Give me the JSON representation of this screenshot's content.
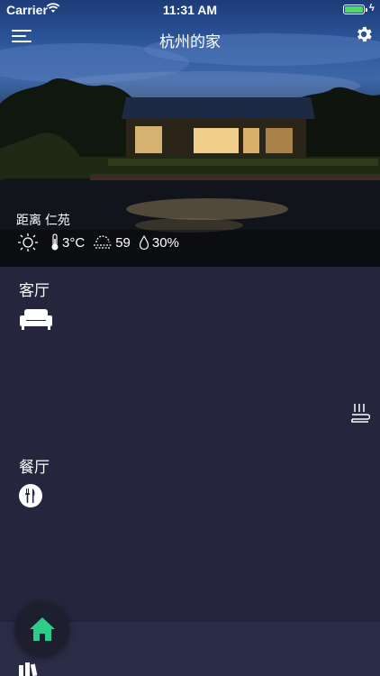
{
  "status_bar": {
    "carrier": "Carrier",
    "time": "11:31 AM",
    "battery_level": 1.0
  },
  "navbar": {
    "title": "杭州的家"
  },
  "hero": {
    "location": "距离 仁苑",
    "weather": [
      {
        "icon": "sun-icon",
        "value": ""
      },
      {
        "icon": "thermometer-icon",
        "value": "3°C"
      },
      {
        "icon": "haze-icon",
        "value": "59"
      },
      {
        "icon": "humidity-icon",
        "value": "30%"
      }
    ]
  },
  "rooms": [
    {
      "name": "客厅",
      "icon": "sofa-icon"
    },
    {
      "name": "餐厅",
      "icon": "cutlery-icon"
    }
  ],
  "colors": {
    "accent_green": "#2ecc8a",
    "battery_green": "#4cd964",
    "room_bg": "#25253d"
  }
}
